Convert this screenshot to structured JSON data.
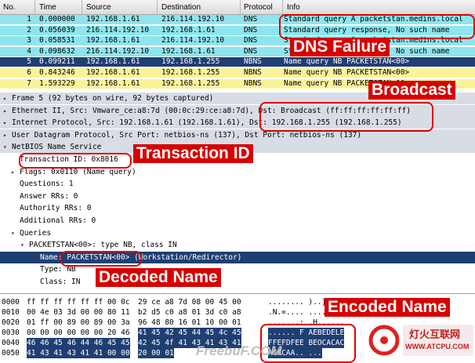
{
  "packet_list": {
    "columns": [
      "No.",
      "Time",
      "Source",
      "Destination",
      "Protocol",
      "Info"
    ],
    "rows": [
      {
        "no": "1",
        "time": "0.000000",
        "src": "192.168.1.61",
        "dst": "216.114.192.10",
        "proto": "DNS",
        "info": "Standard query A packetstan.medins.local",
        "bg": "#8ee5ee",
        "fg": "#000000"
      },
      {
        "no": "2",
        "time": "0.056039",
        "src": "216.114.192.10",
        "dst": "192.168.1.61",
        "proto": "DNS",
        "info": "Standard query response, No such name",
        "bg": "#8ee5ee",
        "fg": "#000000"
      },
      {
        "no": "3",
        "time": "0.058531",
        "src": "192.168.1.61",
        "dst": "216.114.192.10",
        "proto": "DNS",
        "info": "Standard query A packetstan.medins.local",
        "bg": "#8ee5ee",
        "fg": "#000000"
      },
      {
        "no": "4",
        "time": "0.098632",
        "src": "216.114.192.10",
        "dst": "192.168.1.61",
        "proto": "DNS",
        "info": "Standard query response, No such name",
        "bg": "#8ee5ee",
        "fg": "#000000"
      },
      {
        "no": "5",
        "time": "0.099211",
        "src": "192.168.1.61",
        "dst": "192.168.1.255",
        "proto": "NBNS",
        "info": "Name query NB PACKETSTAN<00>",
        "bg": "#1f3f73",
        "fg": "#ffffff"
      },
      {
        "no": "6",
        "time": "0.843246",
        "src": "192.168.1.61",
        "dst": "192.168.1.255",
        "proto": "NBNS",
        "info": "Name query NB PACKETSTAN<00>",
        "bg": "#fbf39a",
        "fg": "#000000"
      },
      {
        "no": "7",
        "time": "1.593229",
        "src": "192.168.1.61",
        "dst": "192.168.1.255",
        "proto": "NBNS",
        "info": "Name query NB PACKETSTAN<00>",
        "bg": "#fbf39a",
        "fg": "#000000"
      }
    ]
  },
  "details": [
    {
      "indent": 0,
      "arrow": "right",
      "text": "Frame 5 (92 bytes on wire, 92 bytes captured)",
      "style": "hl"
    },
    {
      "indent": 0,
      "arrow": "right",
      "text": "Ethernet II, Src: Vmware_ce:a8:7d (00:0c:29:ce:a8:7d), Dst: Broadcast (ff:ff:ff:ff:ff:ff)",
      "style": "hl"
    },
    {
      "indent": 0,
      "arrow": "right",
      "text": "Internet Protocol, Src: 192.168.1.61 (192.168.1.61), Dst: 192.168.1.255 (192.168.1.255)",
      "style": "hl"
    },
    {
      "indent": 0,
      "arrow": "right",
      "text": "User Datagram Protocol, Src Port: netbios-ns (137), Dst Port: netbios-ns (137)",
      "style": "hl"
    },
    {
      "indent": 0,
      "arrow": "down",
      "text": "NetBIOS Name Service",
      "style": "hl"
    },
    {
      "indent": 1,
      "arrow": "",
      "text": "Transaction ID: 0x8016",
      "style": ""
    },
    {
      "indent": 1,
      "arrow": "right",
      "text": "Flags: 0x0110 (Name query)",
      "style": ""
    },
    {
      "indent": 1,
      "arrow": "",
      "text": "Questions: 1",
      "style": ""
    },
    {
      "indent": 1,
      "arrow": "",
      "text": "Answer RRs: 0",
      "style": ""
    },
    {
      "indent": 1,
      "arrow": "",
      "text": "Authority RRs: 0",
      "style": ""
    },
    {
      "indent": 1,
      "arrow": "",
      "text": "Additional RRs: 0",
      "style": ""
    },
    {
      "indent": 1,
      "arrow": "down",
      "text": "Queries",
      "style": ""
    },
    {
      "indent": 2,
      "arrow": "down",
      "text": "PACKETSTAN<00>: type NB, class IN",
      "style": ""
    },
    {
      "indent": 3,
      "arrow": "",
      "text": "Name: PACKETSTAN<00> (Workstation/Redirector)",
      "style": "sel"
    },
    {
      "indent": 3,
      "arrow": "",
      "text": "Type: NB",
      "style": ""
    },
    {
      "indent": 3,
      "arrow": "",
      "text": "Class: IN",
      "style": ""
    }
  ],
  "bytes": [
    {
      "off": "0000",
      "hex1": "ff ff ff ff ff ff 00 0c",
      "hex2": "29 ce a8 7d 08 00 45 00",
      "ascii": "........ )..}..E."
    },
    {
      "off": "0010",
      "hex1": "00 4e 03 3d 00 00 80 11",
      "hex2": "b2 d5 c0 a8 01 3d c0 a8",
      "ascii": ".N.=.... .....=.."
    },
    {
      "off": "0020",
      "hex1": "01 ff 00 89 00 89 00 3a",
      "hex2": "96 48 80 16 01 10 00 01",
      "ascii": ".......: .H......"
    },
    {
      "off": "0030",
      "hex1": "00 00 00 00 00 00 20 46",
      "hex2": "41 45 42 45 44 45 4c 45",
      "ascii": "...... F AEBEDELE"
    },
    {
      "off": "0040",
      "hex1": "46 46 45 46 44 46 45 45",
      "hex2": "42 45 4f 41 43 41 43 41",
      "ascii": "FFEFDFEE BEOCACAC"
    },
    {
      "off": "0050",
      "hex1": "41 43 41 43 41 41 00 00",
      "hex2": "20 00 01",
      "ascii": "ACACAA.. ..."
    }
  ],
  "annotations": {
    "dns_failure": "DNS Failure",
    "broadcast": "Broadcast",
    "transaction_id": "Transaction ID",
    "decoded_name": "Decoded Name",
    "encoded_name": "Encoded Name"
  },
  "watermark": {
    "freebuf": "FreebuF.COM",
    "cn_site": "灯火互联网",
    "url": "WWW.ATCPU.COM"
  },
  "colors": {
    "dns_row": "#8ee5ee",
    "nbns_row": "#fbf39a",
    "selected": "#1f3f73",
    "annotation": "#d80000"
  }
}
